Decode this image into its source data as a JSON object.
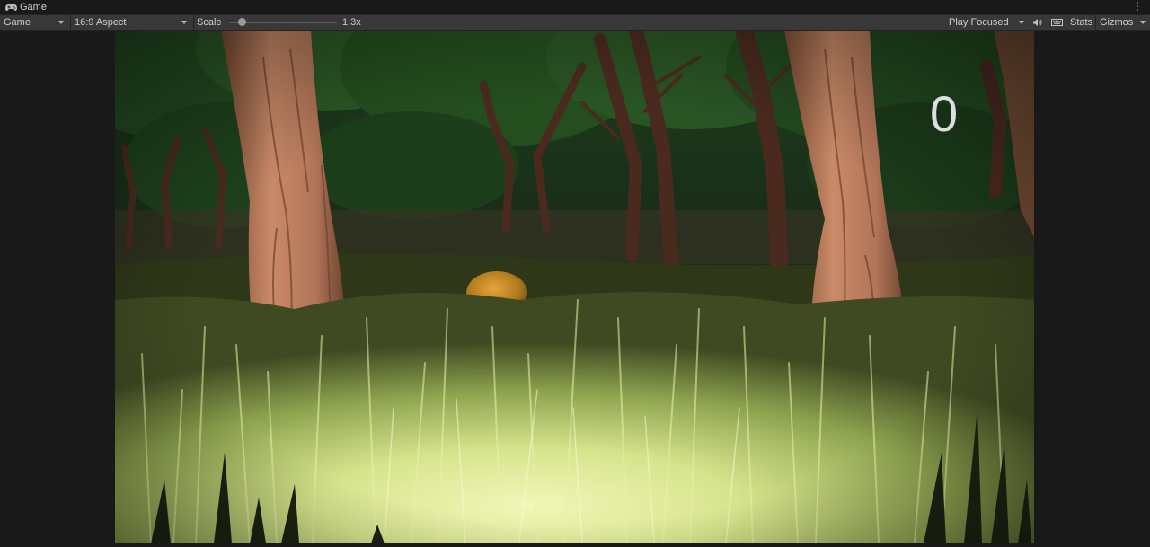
{
  "window": {
    "tab_title": "Game",
    "tab_icon": "gamepad-icon",
    "menu_icon": "kebab-menu-icon"
  },
  "toolbar": {
    "display_select": "Game",
    "aspect_select": "16:9 Aspect",
    "scale_label": "Scale",
    "scale_value": "1.3x",
    "play_mode_select": "Play Focused",
    "audio_icon": "speaker-icon",
    "stats_panel_icon": "keyboard-icon",
    "stats_label": "Stats",
    "gizmos_label": "Gizmos"
  },
  "game": {
    "score": "0",
    "scene": "night forest with tall grass, tree trunks and a glowing orange orb"
  },
  "colors": {
    "editor_bg": "#191919",
    "toolbar_bg": "#383838",
    "score_text": "#dedede"
  }
}
